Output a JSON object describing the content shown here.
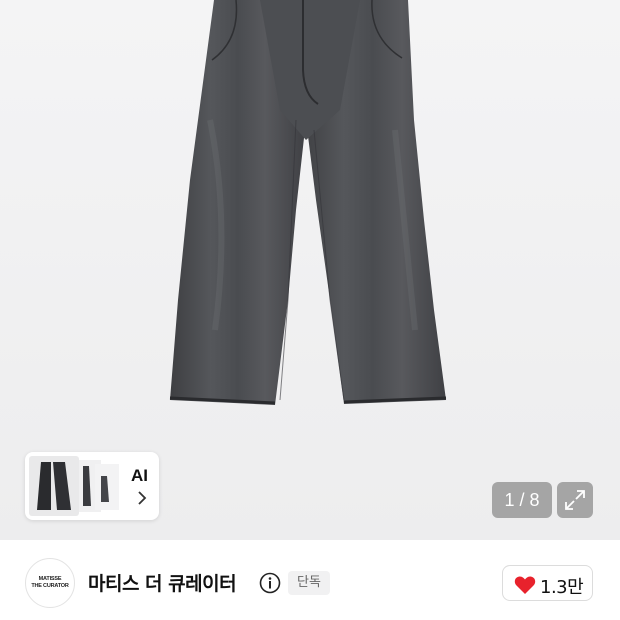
{
  "product_gallery": {
    "product_image_alt": "product-image-gray-wide-jeans",
    "counter": "1 / 8",
    "expand_icon": "expand-icon",
    "ai_card": {
      "label": "AI",
      "chevron_icon": "chevron-right-icon"
    }
  },
  "brand": {
    "logo_line1": "MATISSE",
    "logo_line2": "THE CURATOR",
    "name": "마티스 더 큐레이터",
    "info_icon": "info-icon",
    "badge": "단독",
    "like_icon": "heart-icon",
    "like_count": "1.3만",
    "like_color": "#e8222c"
  }
}
